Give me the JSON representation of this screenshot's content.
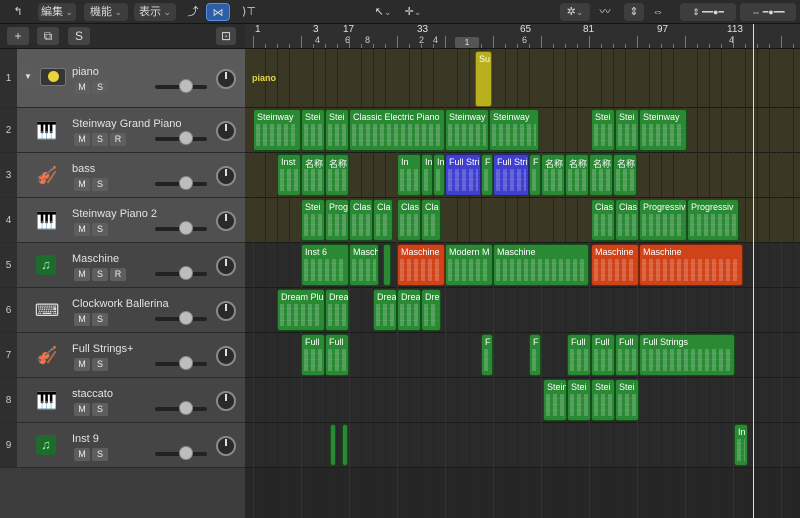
{
  "toolbar": {
    "back_glyph": "↰",
    "menus": [
      "編集",
      "機能",
      "表示"
    ],
    "tool_pointer": "pointer-icon",
    "tool_plus": "plus-icon"
  },
  "header_buttons": {
    "add": "+",
    "duplicate": "⧉",
    "s": "S"
  },
  "ruler": {
    "bars": [
      {
        "num": "1",
        "sub": ""
      },
      {
        "num": "3",
        "sub": "4"
      },
      {
        "num": "17",
        "sub": "6"
      },
      {
        "num": "",
        "sub": "8"
      },
      {
        "num": "33",
        "sub": "2"
      },
      {
        "num": "",
        "sub": "4"
      },
      {
        "num": "65",
        "sub": "6"
      },
      {
        "num": "81",
        "sub": ""
      },
      {
        "num": "97",
        "sub": ""
      },
      {
        "num": "113",
        "sub": "4"
      }
    ],
    "locator_label": "1"
  },
  "tracks": [
    {
      "num": "1",
      "name": "piano",
      "buttons": [
        "M",
        "S"
      ],
      "icon": "stack-icon",
      "kind": "stack"
    },
    {
      "num": "2",
      "name": "Steinway Grand Piano",
      "buttons": [
        "M",
        "S",
        "R"
      ],
      "icon": "grand-piano-icon",
      "kind": "child"
    },
    {
      "num": "3",
      "name": "bass",
      "buttons": [
        "M",
        "S"
      ],
      "icon": "bass-icon",
      "kind": "child"
    },
    {
      "num": "4",
      "name": "Steinway Piano 2",
      "buttons": [
        "M",
        "S"
      ],
      "icon": "grand-piano-icon",
      "kind": "child"
    },
    {
      "num": "5",
      "name": "Maschine",
      "buttons": [
        "M",
        "S",
        "R"
      ],
      "icon": "synth-icon",
      "kind": "normal"
    },
    {
      "num": "6",
      "name": "Clockwork Ballerina",
      "buttons": [
        "M",
        "S"
      ],
      "icon": "keyboard-stand-icon",
      "kind": "normal"
    },
    {
      "num": "7",
      "name": "Full Strings+",
      "buttons": [
        "M",
        "S"
      ],
      "icon": "violin-icon",
      "kind": "normal"
    },
    {
      "num": "8",
      "name": "staccato",
      "buttons": [
        "M",
        "S"
      ],
      "icon": "grand-piano-icon",
      "kind": "normal"
    },
    {
      "num": "9",
      "name": "Inst 9",
      "buttons": [
        "M",
        "S"
      ],
      "icon": "synth-icon",
      "kind": "normal"
    }
  ],
  "folder_label": "piano",
  "folder_summary_label": "Su",
  "regions": [
    {
      "track": 0,
      "start": 230,
      "len": 17,
      "label": "Su",
      "color": "#b8b01c"
    },
    {
      "track": 1,
      "start": 8,
      "len": 48,
      "label": "Steinway",
      "color": "#2a8a34"
    },
    {
      "track": 1,
      "start": 56,
      "len": 24,
      "label": "Stei",
      "color": "#2a8a34"
    },
    {
      "track": 1,
      "start": 80,
      "len": 24,
      "label": "Stei",
      "color": "#2a8a34"
    },
    {
      "track": 1,
      "start": 104,
      "len": 96,
      "label": "Classic Electric Piano",
      "color": "#2a8a34"
    },
    {
      "track": 1,
      "start": 200,
      "len": 44,
      "label": "Steinway G",
      "color": "#2a8a34"
    },
    {
      "track": 1,
      "start": 244,
      "len": 50,
      "label": "Steinway",
      "color": "#2a8a34"
    },
    {
      "track": 1,
      "start": 346,
      "len": 24,
      "label": "Stei",
      "color": "#2a8a34"
    },
    {
      "track": 1,
      "start": 370,
      "len": 24,
      "label": "Stei",
      "color": "#2a8a34"
    },
    {
      "track": 1,
      "start": 394,
      "len": 48,
      "label": "Steinway",
      "color": "#2a8a34"
    },
    {
      "track": 2,
      "start": 32,
      "len": 24,
      "label": "Inst",
      "color": "#2a8a34"
    },
    {
      "track": 2,
      "start": 56,
      "len": 24,
      "label": "名称",
      "color": "#2a8a34"
    },
    {
      "track": 2,
      "start": 80,
      "len": 24,
      "label": "名称",
      "color": "#2a8a34"
    },
    {
      "track": 2,
      "start": 152,
      "len": 24,
      "label": "In",
      "color": "#2a8a34"
    },
    {
      "track": 2,
      "start": 176,
      "len": 12,
      "label": "In",
      "color": "#2a8a34"
    },
    {
      "track": 2,
      "start": 188,
      "len": 12,
      "label": "In",
      "color": "#2a8a34"
    },
    {
      "track": 2,
      "start": 200,
      "len": 36,
      "label": "Full Stri",
      "color": "#4040d0"
    },
    {
      "track": 2,
      "start": 236,
      "len": 12,
      "label": "F",
      "color": "#2a8a34"
    },
    {
      "track": 2,
      "start": 248,
      "len": 36,
      "label": "Full Stri",
      "color": "#4040d0"
    },
    {
      "track": 2,
      "start": 284,
      "len": 12,
      "label": "F",
      "color": "#2a8a34"
    },
    {
      "track": 2,
      "start": 296,
      "len": 24,
      "label": "名称",
      "color": "#2a8a34"
    },
    {
      "track": 2,
      "start": 320,
      "len": 24,
      "label": "名称",
      "color": "#2a8a34"
    },
    {
      "track": 2,
      "start": 344,
      "len": 24,
      "label": "名称",
      "color": "#2a8a34"
    },
    {
      "track": 2,
      "start": 368,
      "len": 24,
      "label": "名称",
      "color": "#2a8a34"
    },
    {
      "track": 3,
      "start": 56,
      "len": 24,
      "label": "Stei",
      "color": "#2a8a34"
    },
    {
      "track": 3,
      "start": 80,
      "len": 24,
      "label": "Prog",
      "color": "#2a8a34"
    },
    {
      "track": 3,
      "start": 104,
      "len": 24,
      "label": "Clas",
      "color": "#2a8a34"
    },
    {
      "track": 3,
      "start": 128,
      "len": 20,
      "label": "Cla",
      "color": "#2a8a34"
    },
    {
      "track": 3,
      "start": 152,
      "len": 24,
      "label": "Clas",
      "color": "#2a8a34"
    },
    {
      "track": 3,
      "start": 176,
      "len": 20,
      "label": "Cla",
      "color": "#2a8a34"
    },
    {
      "track": 3,
      "start": 346,
      "len": 24,
      "label": "Clas",
      "color": "#2a8a34"
    },
    {
      "track": 3,
      "start": 370,
      "len": 24,
      "label": "Clas",
      "color": "#2a8a34"
    },
    {
      "track": 3,
      "start": 394,
      "len": 48,
      "label": "Progressiv",
      "color": "#2a8a34"
    },
    {
      "track": 3,
      "start": 442,
      "len": 52,
      "label": "Progressiv",
      "color": "#2a8a34"
    },
    {
      "track": 4,
      "start": 56,
      "len": 48,
      "label": "Inst 6",
      "color": "#2a8a34"
    },
    {
      "track": 4,
      "start": 104,
      "len": 30,
      "label": "Masch",
      "color": "#2a8a34"
    },
    {
      "track": 4,
      "start": 138,
      "len": 8,
      "label": "",
      "color": "#2a8a34"
    },
    {
      "track": 4,
      "start": 152,
      "len": 48,
      "label": "Maschine",
      "color": "#d04218"
    },
    {
      "track": 4,
      "start": 200,
      "len": 48,
      "label": "Modern M",
      "color": "#2a8a34"
    },
    {
      "track": 4,
      "start": 248,
      "len": 96,
      "label": "Maschine",
      "color": "#2a8a34"
    },
    {
      "track": 4,
      "start": 346,
      "len": 48,
      "label": "Maschine",
      "color": "#d04218"
    },
    {
      "track": 4,
      "start": 394,
      "len": 104,
      "label": "Maschine",
      "color": "#d04218"
    },
    {
      "track": 5,
      "start": 32,
      "len": 48,
      "label": "Dream Plu",
      "color": "#2a8a34"
    },
    {
      "track": 5,
      "start": 80,
      "len": 24,
      "label": "Drea",
      "color": "#2a8a34"
    },
    {
      "track": 5,
      "start": 128,
      "len": 24,
      "label": "Drea",
      "color": "#2a8a34"
    },
    {
      "track": 5,
      "start": 152,
      "len": 24,
      "label": "Drea",
      "color": "#2a8a34"
    },
    {
      "track": 5,
      "start": 176,
      "len": 20,
      "label": "Dre",
      "color": "#2a8a34"
    },
    {
      "track": 6,
      "start": 56,
      "len": 24,
      "label": "Full",
      "color": "#2a8a34"
    },
    {
      "track": 6,
      "start": 80,
      "len": 24,
      "label": "Full",
      "color": "#2a8a34"
    },
    {
      "track": 6,
      "start": 236,
      "len": 12,
      "label": "F",
      "color": "#2a8a34"
    },
    {
      "track": 6,
      "start": 284,
      "len": 12,
      "label": "F",
      "color": "#2a8a34"
    },
    {
      "track": 6,
      "start": 322,
      "len": 24,
      "label": "Full",
      "color": "#2a8a34"
    },
    {
      "track": 6,
      "start": 346,
      "len": 24,
      "label": "Full",
      "color": "#2a8a34"
    },
    {
      "track": 6,
      "start": 370,
      "len": 24,
      "label": "Full",
      "color": "#2a8a34"
    },
    {
      "track": 6,
      "start": 394,
      "len": 96,
      "label": "Full Strings",
      "color": "#2a8a34"
    },
    {
      "track": 7,
      "start": 298,
      "len": 24,
      "label": "Stein",
      "color": "#2a8a34"
    },
    {
      "track": 7,
      "start": 322,
      "len": 24,
      "label": "Stei",
      "color": "#2a8a34"
    },
    {
      "track": 7,
      "start": 346,
      "len": 24,
      "label": "Stei",
      "color": "#2a8a34"
    },
    {
      "track": 7,
      "start": 370,
      "len": 24,
      "label": "Stei",
      "color": "#2a8a34"
    },
    {
      "track": 8,
      "start": 85,
      "len": 6,
      "label": "",
      "color": "#2a8a34"
    },
    {
      "track": 8,
      "start": 97,
      "len": 6,
      "label": "",
      "color": "#2a8a34"
    },
    {
      "track": 8,
      "start": 489,
      "len": 14,
      "label": "In",
      "color": "#2a8a34"
    }
  ]
}
